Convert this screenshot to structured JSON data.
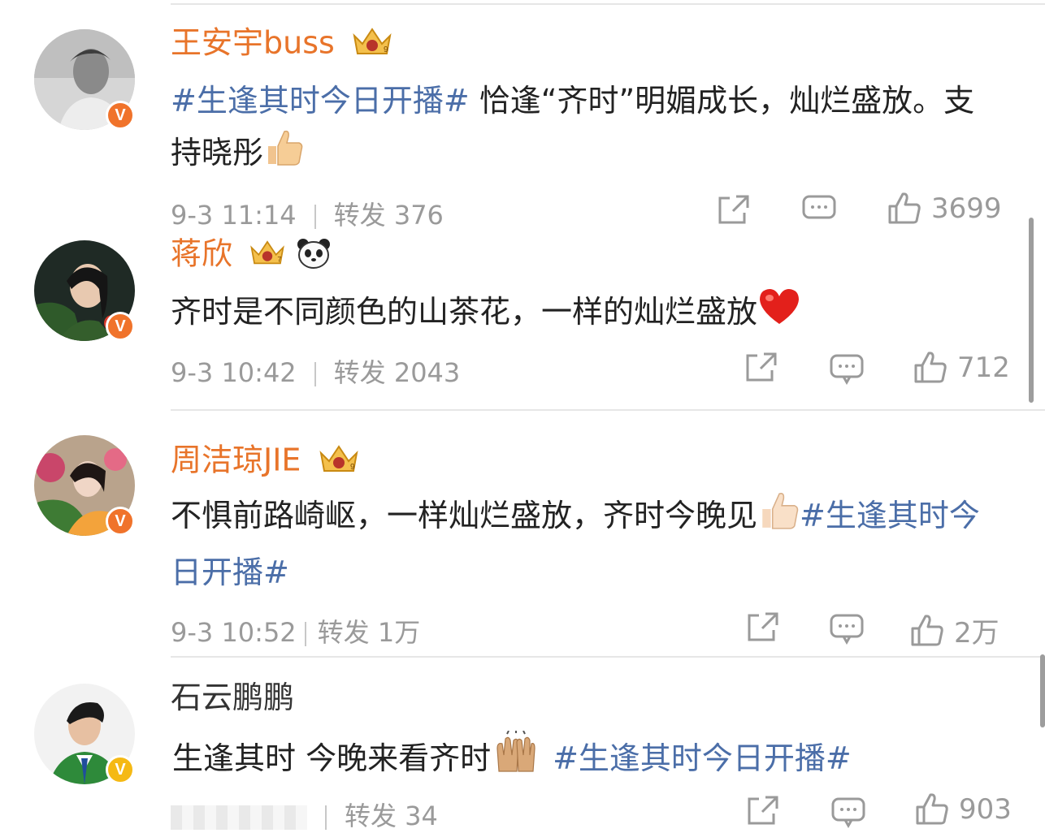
{
  "comments": [
    {
      "name": "王安宇buss",
      "crown_level": "9",
      "text_tag": "#生逢其时今日开播#",
      "text_main": " 恰逢“齐时”明媚成长，灿烂盛放。支持晓彤",
      "text_emoji": "thumbs-up",
      "date": "9-3 11:14",
      "repost_label": "转发 376",
      "like_count": "3699"
    },
    {
      "name": "蒋欣",
      "crown_level": "7",
      "text_main": "齐时是不同颜色的山茶花，一样的灿烂盛放",
      "text_emoji": "red-heart",
      "date": "9-3 10:42",
      "repost_label": "转发 2043",
      "like_count": "712"
    },
    {
      "name": "周洁琼JIE",
      "crown_level": "9",
      "text_main": "不惧前路崎岖，一样灿烂盛放，齐时今晚见",
      "text_emoji": "thumbs-up",
      "text_tag": "#生逢其时今日开播#",
      "date": "9-3 10:52",
      "repost_label": "转发 1万",
      "like_count": "2万"
    },
    {
      "name": "石云鹏鹏",
      "text_main": "生逢其时 今晚来看齐时",
      "text_emoji": "raised-hands",
      "text_tag": "#生逢其时今日开播#",
      "repost_label": "转发 34",
      "like_count": "903"
    }
  ],
  "badge_letter": "V",
  "colors": {
    "vip_name": "#e8742a",
    "hashtag": "#4b6ea8",
    "meta": "#9a9a9a",
    "badge_orange": "#f0732b",
    "badge_yellow": "#f5b914"
  }
}
